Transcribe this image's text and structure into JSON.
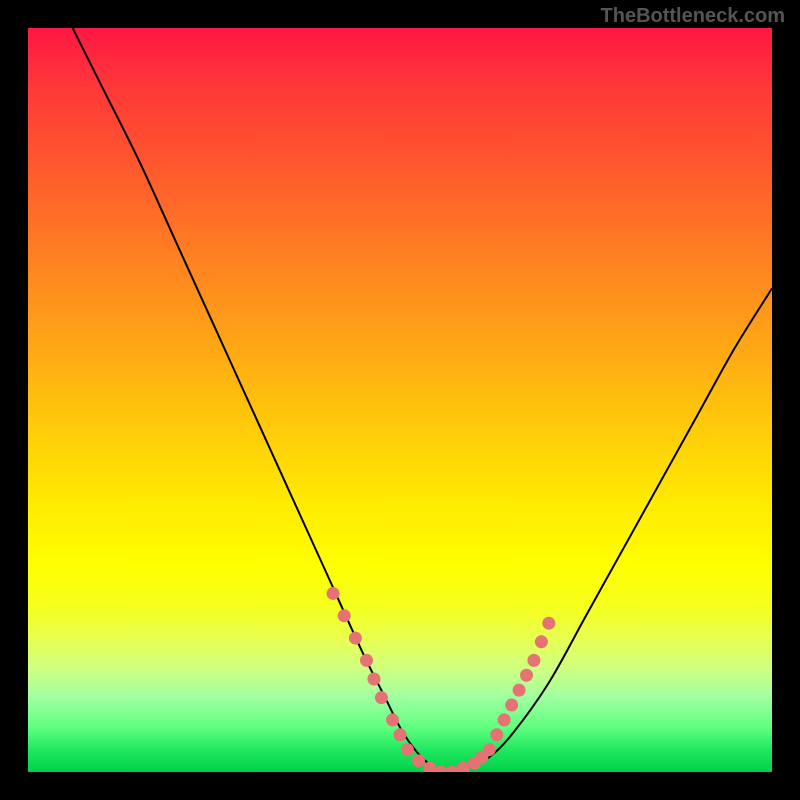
{
  "watermark": "TheBottleneck.com",
  "chart_data": {
    "type": "line",
    "title": "",
    "xlabel": "",
    "ylabel": "",
    "xlim": [
      0,
      100
    ],
    "ylim": [
      0,
      100
    ],
    "description": "Bottleneck curve with minimum valley region; heat gradient background",
    "x": [
      6,
      10,
      15,
      20,
      25,
      30,
      35,
      40,
      45,
      48,
      50,
      52,
      54,
      56,
      58,
      60,
      62,
      65,
      70,
      75,
      80,
      85,
      90,
      95,
      100
    ],
    "values": [
      100,
      92,
      82,
      71,
      60,
      49,
      38,
      27,
      16,
      10,
      6,
      3,
      1,
      0,
      0,
      1,
      2,
      5,
      12,
      21,
      30,
      39,
      48,
      57,
      65
    ],
    "series": [
      {
        "name": "bottleneck-curve",
        "x": [
          6,
          10,
          15,
          20,
          25,
          30,
          35,
          40,
          45,
          48,
          50,
          52,
          54,
          56,
          58,
          60,
          62,
          65,
          70,
          75,
          80,
          85,
          90,
          95,
          100
        ],
        "y": [
          100,
          92,
          82,
          71,
          60,
          49,
          38,
          27,
          16,
          10,
          6,
          3,
          1,
          0,
          0,
          1,
          2,
          5,
          12,
          21,
          30,
          39,
          48,
          57,
          65
        ]
      }
    ],
    "dots_left": [
      {
        "x": 41,
        "y": 24
      },
      {
        "x": 42.5,
        "y": 21
      },
      {
        "x": 44,
        "y": 18
      },
      {
        "x": 45.5,
        "y": 15
      },
      {
        "x": 46.5,
        "y": 12.5
      },
      {
        "x": 47.5,
        "y": 10
      },
      {
        "x": 49,
        "y": 7
      },
      {
        "x": 50,
        "y": 5
      }
    ],
    "dots_bottom": [
      {
        "x": 51,
        "y": 3
      },
      {
        "x": 52.5,
        "y": 1.5
      },
      {
        "x": 54,
        "y": 0.5
      },
      {
        "x": 55.5,
        "y": 0
      },
      {
        "x": 57,
        "y": 0
      },
      {
        "x": 58.5,
        "y": 0.5
      },
      {
        "x": 60,
        "y": 1.2
      },
      {
        "x": 61,
        "y": 2
      }
    ],
    "dots_right": [
      {
        "x": 62,
        "y": 3
      },
      {
        "x": 63,
        "y": 5
      },
      {
        "x": 64,
        "y": 7
      },
      {
        "x": 65,
        "y": 9
      },
      {
        "x": 66,
        "y": 11
      },
      {
        "x": 67,
        "y": 13
      },
      {
        "x": 68,
        "y": 15
      },
      {
        "x": 69,
        "y": 17.5
      },
      {
        "x": 70,
        "y": 20
      }
    ],
    "gradient_colors": {
      "top": "#ff1744",
      "mid": "#ffeb00",
      "bottom": "#00d048"
    }
  }
}
